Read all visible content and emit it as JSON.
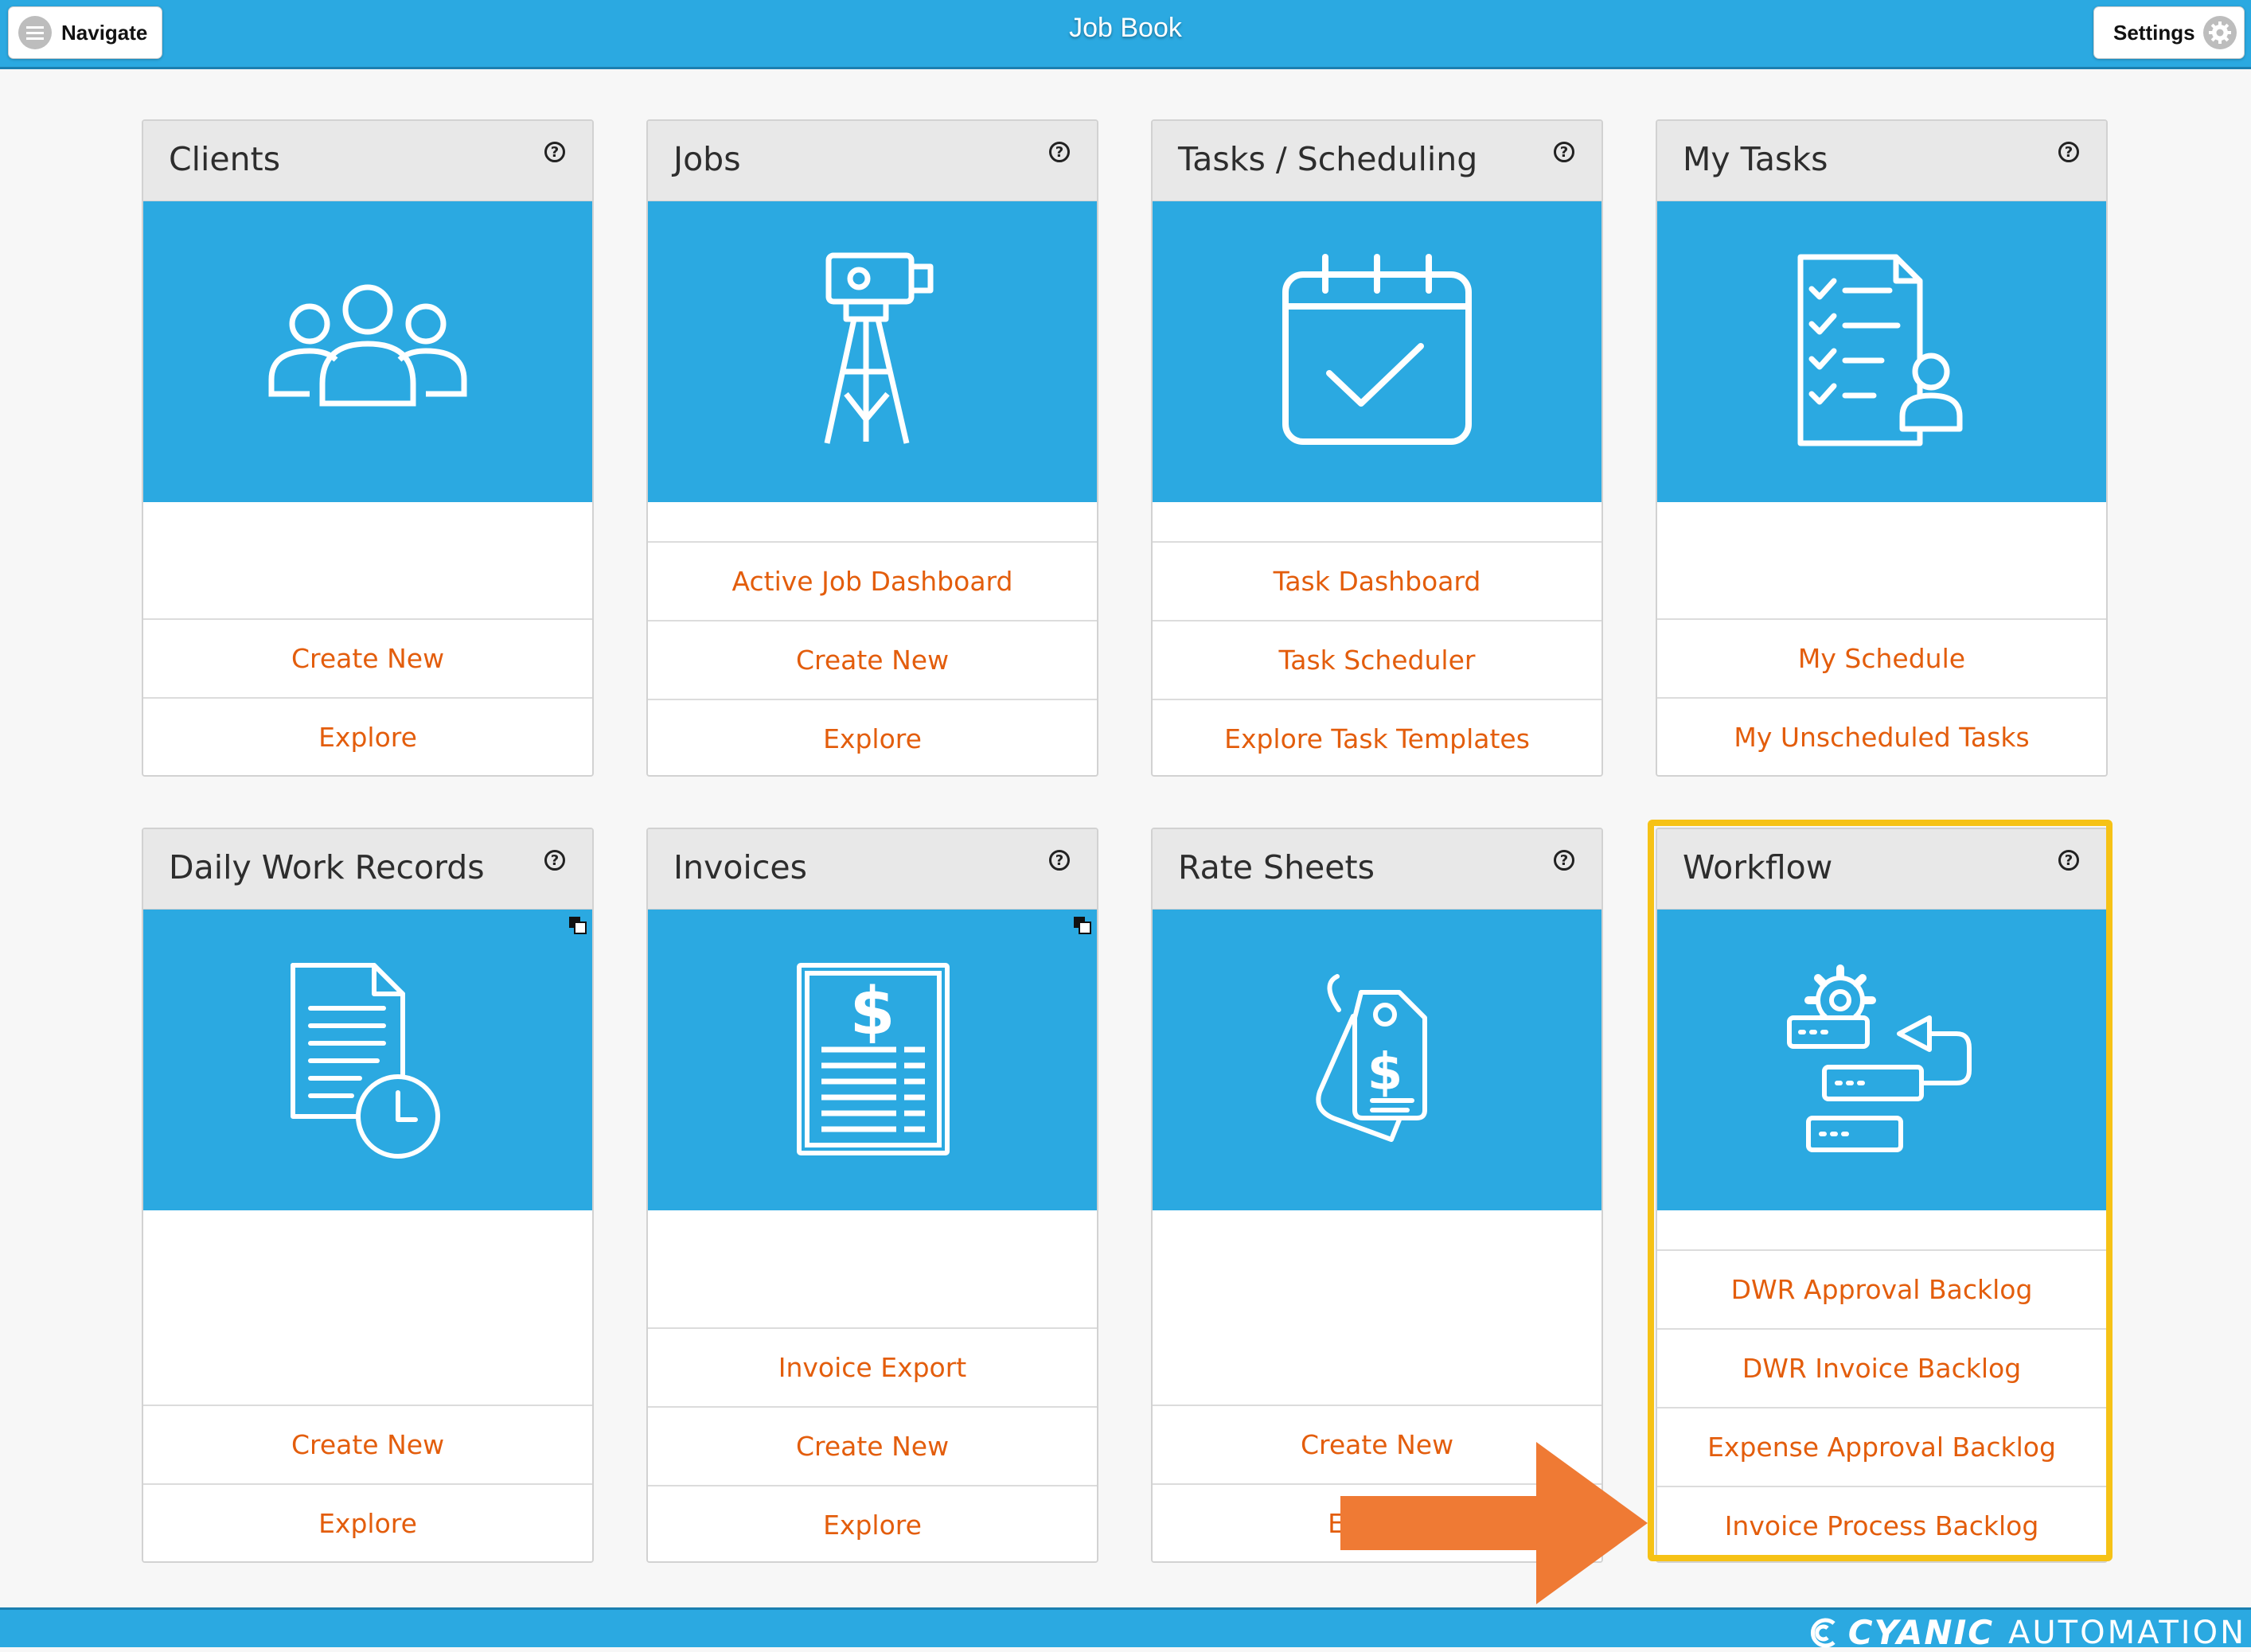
{
  "header": {
    "title": "Job Book",
    "navigate_label": "Navigate",
    "settings_label": "Settings"
  },
  "cards": {
    "clients": {
      "title": "Clients",
      "icon": "people-icon",
      "links": [
        "Create New",
        "Explore"
      ]
    },
    "jobs": {
      "title": "Jobs",
      "icon": "survey-tripod-icon",
      "links": [
        "Active Job Dashboard",
        "Create New",
        "Explore"
      ]
    },
    "tasks": {
      "title": "Tasks / Scheduling",
      "icon": "calendar-check-icon",
      "links": [
        "Task Dashboard",
        "Task Scheduler",
        "Explore Task Templates"
      ]
    },
    "mytasks": {
      "title": "My Tasks",
      "icon": "checklist-person-icon",
      "links": [
        "My Schedule",
        "My Unscheduled Tasks"
      ]
    },
    "dwr": {
      "title": "Daily Work Records",
      "icon": "document-clock-icon",
      "links": [
        "Create New",
        "Explore"
      ]
    },
    "invoices": {
      "title": "Invoices",
      "icon": "invoice-dollar-icon",
      "links": [
        "Invoice Export",
        "Create New",
        "Explore"
      ]
    },
    "ratesheets": {
      "title": "Rate Sheets",
      "icon": "price-tag-icon",
      "links": [
        "Create New",
        "Explore"
      ]
    },
    "workflow": {
      "title": "Workflow",
      "icon": "workflow-gear-icon",
      "links": [
        "DWR Approval Backlog",
        "DWR Invoice Backlog",
        "Expense Approval Backlog",
        "Invoice Process Backlog"
      ]
    }
  },
  "help_glyph": "?",
  "footer": {
    "brand_bold": "CYANIC",
    "brand_light": "AUTOMATION"
  },
  "colors": {
    "primary": "#2ba9e1",
    "link": "#e35d0c",
    "highlight": "#f6c216",
    "arrow": "#ef7a34"
  }
}
